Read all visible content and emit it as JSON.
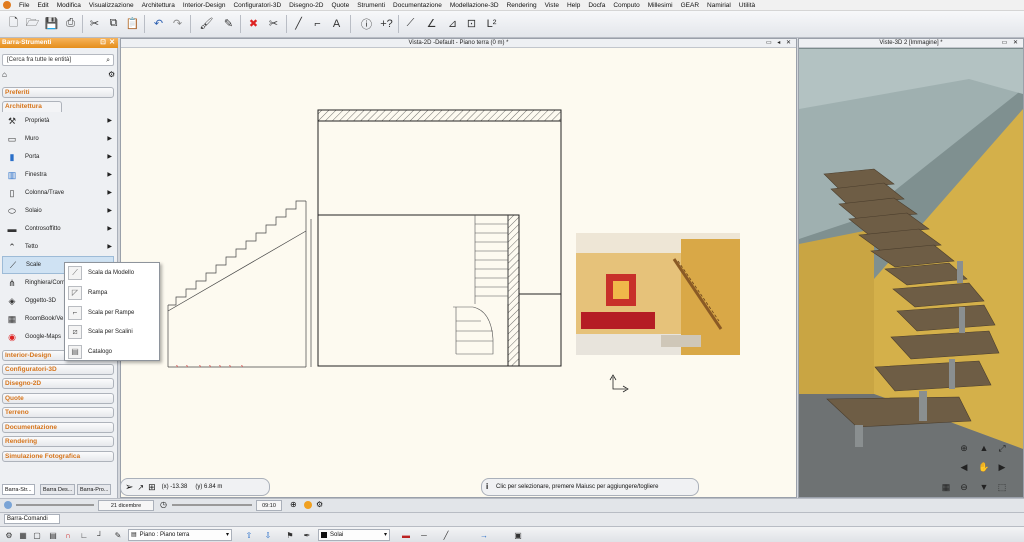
{
  "menubar": {
    "items": [
      "File",
      "Edit",
      "Modifica",
      "Visualizzazione",
      "Architettura",
      "Interior-Design",
      "Configuratori-3D",
      "Disegno-2D",
      "Quote",
      "Strumenti",
      "Documentazione",
      "Modellazione-3D",
      "Rendering",
      "Viste",
      "Help",
      "Docfa",
      "Computo",
      "Millesimi",
      "GEAR",
      "Namirial",
      "Utilità"
    ]
  },
  "left_panel": {
    "title": "Barra-Strumenti",
    "search_placeholder": "[Cerca fra tutte le entità]",
    "categories_top": [
      "Preferiti",
      "Architettura"
    ],
    "items": [
      {
        "label": "Proprietà",
        "icon": "properties-icon"
      },
      {
        "label": "Muro",
        "icon": "wall-icon"
      },
      {
        "label": "Porta",
        "icon": "door-icon"
      },
      {
        "label": "Finestra",
        "icon": "window-icon"
      },
      {
        "label": "Colonna/Trave",
        "icon": "column-icon"
      },
      {
        "label": "Solaio",
        "icon": "slab-icon"
      },
      {
        "label": "Controsoffitto",
        "icon": "ceiling-icon"
      },
      {
        "label": "Tetto",
        "icon": "roof-icon"
      },
      {
        "label": "Scale",
        "icon": "stairs-icon"
      },
      {
        "label": "Ringhiera/Corr",
        "icon": "railing-icon"
      },
      {
        "label": "Oggetto-3D",
        "icon": "object3d-icon"
      },
      {
        "label": "RoomBook/Ve",
        "icon": "roombook-icon"
      },
      {
        "label": "Google-Maps",
        "icon": "maps-icon"
      }
    ],
    "categories_bottom": [
      "Interior-Design",
      "Configuratori-3D",
      "Disegno-2D",
      "Quote",
      "Terreno",
      "Documentazione",
      "Rendering",
      "Simulazione Fotografica"
    ],
    "tabs": [
      "Barra-Str...",
      "Barra Des...",
      "Barra-Pro..."
    ]
  },
  "popup_menu": {
    "items": [
      "Scala da Modello",
      "Rampa",
      "Scala per Rampe",
      "Scala per Scalini",
      "Catalogo"
    ]
  },
  "view2d": {
    "title": "Vista-2D -Default - Piano terra (0 m) *"
  },
  "view3d": {
    "title": "Viste-3D 2 [Immagine] *"
  },
  "coordbar": {
    "x": "(x) -13.38",
    "y": "(y) 6.84 m"
  },
  "hintbar": {
    "text": "Clic per selezionare, premere Maiusc per aggiungere/togliere"
  },
  "timebar": {
    "date": "21 dicembre",
    "time": "09:10"
  },
  "cmdbar": {
    "label": "Barra-Comandi"
  },
  "bottombar": {
    "floor": "Piano : Piano terra",
    "layer": "Solai"
  },
  "colors": {
    "accent_orange": "#e58e1c",
    "drawing_bg": "#fdfaf0",
    "category_text": "#d6741a"
  }
}
